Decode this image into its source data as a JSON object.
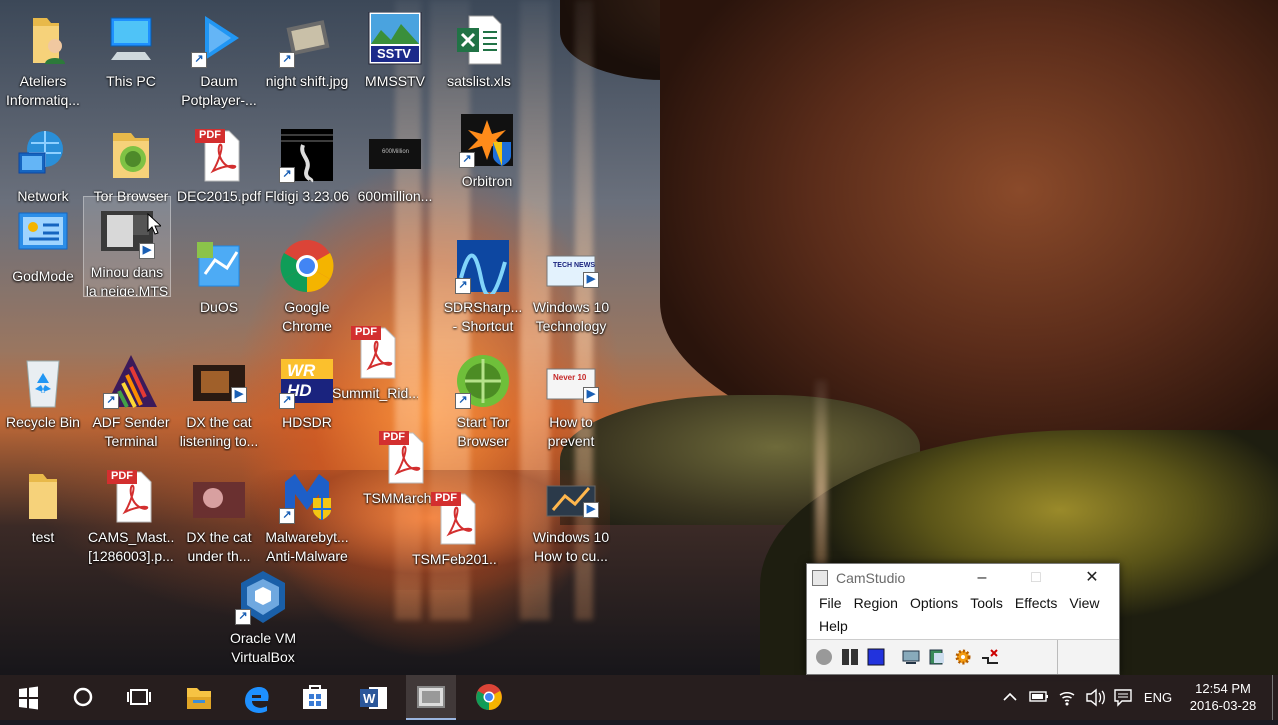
{
  "desktop": {
    "icons": [
      {
        "label": "Ateliers Informatiq...",
        "icon": "user-folder-icon"
      },
      {
        "label": "This PC",
        "icon": "computer-icon"
      },
      {
        "label": "Daum Potplayer-...",
        "icon": "play-icon"
      },
      {
        "label": "night shift.jpg",
        "icon": "image-file-icon"
      },
      {
        "label": "MMSSTV",
        "icon": "mmsstv-icon",
        "glyph_text": "SSTV"
      },
      {
        "label": "satslist.xls",
        "icon": "excel-file-icon"
      },
      {
        "label": "Network",
        "icon": "network-globe-icon"
      },
      {
        "label": "Tor Browser",
        "icon": "tor-folder-icon"
      },
      {
        "label": "DEC2015.pdf",
        "icon": "pdf-file-icon",
        "glyph_text": "PDF"
      },
      {
        "label": "Fldigi 3.23.06",
        "icon": "fldigi-icon"
      },
      {
        "label": "600million...",
        "icon": "video-file-icon",
        "glyph_text": "600Million"
      },
      {
        "label": "Orbitron",
        "icon": "orbitron-icon"
      },
      {
        "label": "GodMode",
        "icon": "control-panel-icon"
      },
      {
        "label": "Minou dans la neige.MTS",
        "icon": "video-file-icon"
      },
      {
        "label": "DuOS",
        "icon": "duos-icon"
      },
      {
        "label": "Google Chrome",
        "icon": "chrome-icon"
      },
      {
        "label": "Summit_Rid...",
        "icon": "pdf-file-icon",
        "glyph_text": "PDF"
      },
      {
        "label": "SDRSharp... - Shortcut",
        "icon": "sdrsharp-icon"
      },
      {
        "label": "Windows 10 Technology ...",
        "icon": "video-file-icon",
        "glyph_text": "TECH NEWS"
      },
      {
        "label": "Recycle Bin",
        "icon": "recycle-bin-icon"
      },
      {
        "label": "ADF Sender Terminal",
        "icon": "adf-icon"
      },
      {
        "label": "DX the cat listening to...",
        "icon": "video-file-icon"
      },
      {
        "label": "HDSDR",
        "icon": "hdsdr-icon",
        "glyph_text": "WR HD"
      },
      {
        "label": "Start Tor Browser",
        "icon": "tor-globe-icon"
      },
      {
        "label": "How to prevent Win...",
        "icon": "video-file-icon",
        "glyph_text": "Never 10"
      },
      {
        "label": "TSMMarch...",
        "icon": "pdf-file-icon",
        "glyph_text": "PDF"
      },
      {
        "label": "test",
        "icon": "folder-icon"
      },
      {
        "label": "CAMS_Mast... [1286003].p...",
        "icon": "pdf-file-icon",
        "glyph_text": "PDF"
      },
      {
        "label": "DX the cat under th...",
        "icon": "video-file-icon"
      },
      {
        "label": "Malwarebyt... Anti-Malware",
        "icon": "malwarebytes-icon"
      },
      {
        "label": "TSMFeb201...",
        "icon": "pdf-file-icon",
        "glyph_text": "PDF"
      },
      {
        "label": "Windows 10 How to cu...",
        "icon": "video-file-icon"
      },
      {
        "label": "Oracle VM VirtualBox",
        "icon": "virtualbox-icon"
      }
    ]
  },
  "camstudio": {
    "title": "CamStudio",
    "menus": [
      "File",
      "Region",
      "Options",
      "Tools",
      "Effects",
      "View",
      "Help"
    ],
    "toolbar": [
      "record-icon",
      "pause-icon",
      "stop-icon",
      "monitor-icon",
      "region-icon",
      "settings-gear-icon",
      "options-icon"
    ]
  },
  "taskbar": {
    "items": [
      "start-icon",
      "cortana-icon",
      "task-view-icon",
      "file-explorer-icon",
      "edge-icon",
      "store-icon",
      "word-icon",
      "camstudio-icon",
      "chrome-icon"
    ],
    "tray": {
      "language": "ENG",
      "time": "12:54 PM",
      "date": "2016-03-28"
    }
  },
  "colors": {
    "taskbar_bg": "#281e1e",
    "window_bg": "#ffffff",
    "accent": "#9bb6e0"
  }
}
